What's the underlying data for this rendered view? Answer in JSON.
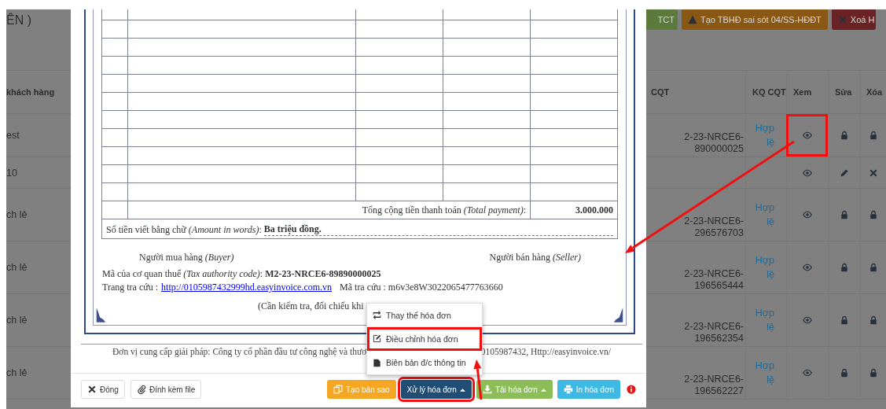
{
  "background_page": {
    "heading_fragment": "ÊN )",
    "toolbar": [
      {
        "label": "TCT",
        "kind": "success"
      },
      {
        "label": "Tạo TBHĐ sai sót 04/SS-HĐĐT",
        "kind": "warning"
      },
      {
        "label": "Xoá H",
        "kind": "danger"
      }
    ],
    "table": {
      "columns": [
        "khách hàng",
        "CQT",
        "KQ CQT",
        "Xem",
        "Sửa",
        "Xóa"
      ],
      "rows": [
        {
          "customer": "est",
          "tax_code": "2-23-NRCE6-890000025",
          "result": "Hợp lệ",
          "view_highlighted": true,
          "locked": true
        },
        {
          "customer": "10",
          "view_highlighted": false,
          "locked": false
        },
        {
          "customer": "ch lẻ",
          "tax_code": "2-23-NRCE6-296576703",
          "result": "Hợp lệ",
          "view_highlighted": false,
          "locked": true
        },
        {
          "customer": "ch lẻ",
          "tax_code": "2-23-NRCE6-196565444",
          "result": "Hợp lệ",
          "view_highlighted": false,
          "locked": true
        },
        {
          "customer": "ch lẻ",
          "tax_code": "2-23-NRCE6-196562354",
          "result": "Hợp lệ",
          "view_highlighted": false,
          "locked": true
        },
        {
          "customer": "ch lẻ",
          "tax_code": "2-23-NRCE6-196562227",
          "result": "Hợp lệ",
          "view_highlighted": false,
          "locked": true
        }
      ]
    }
  },
  "modal": {
    "invoice": {
      "total_label": "Tổng cộng tiền thanh toán *(Total payment)*:",
      "total_value": "3.000.000",
      "amount_label": "Số tiền viết bằng chữ *(Amount in words)*:",
      "amount_value": "Ba triệu đồng.",
      "buyer": "Người mua hàng *(Buyer)*",
      "seller": "Người bán hàng *(Seller)*",
      "tax_authority_code": "Mã của cơ quan thuế *(Tax authority code)*: **M2-23-NRCE6-89890000025**",
      "lookup_label": "Trang tra cứu :",
      "lookup_link": "http://0105987432999hd.easyinvoice.com.vn",
      "lookup_code": "Mã tra cứu : m6v3e8W3022065477763660",
      "note": "(Cần kiểm tra, đối chiếu khi"
    },
    "provider_note": [
      "Đơn vị cung cấp giải pháp: Công ty cổ phần đầu tư công nghệ và thươ",
      "0105987432, Http://easyinvoice.vn/"
    ],
    "left_buttons": [
      {
        "label": "Đóng"
      },
      {
        "label": "Đính kèm file"
      }
    ],
    "right_buttons": [
      {
        "label": "Tạo bản sao",
        "kind": "warning",
        "dropdown": false,
        "highlighted": false
      },
      {
        "label": "Xử lý hóa đơn",
        "kind": "navy",
        "dropdown": true,
        "highlighted": true
      },
      {
        "label": "Tải hóa đơn",
        "kind": "success",
        "dropdown": true,
        "highlighted": false
      },
      {
        "label": "In hóa đơn",
        "kind": "info",
        "dropdown": false,
        "highlighted": false
      }
    ],
    "menu": [
      {
        "label": "Thay thế hóa đơn",
        "highlighted": false
      },
      {
        "label": "Điều chỉnh hóa đơn",
        "highlighted": true
      },
      {
        "label": "Biên bản đ/c thông tin",
        "highlighted": false
      }
    ]
  }
}
